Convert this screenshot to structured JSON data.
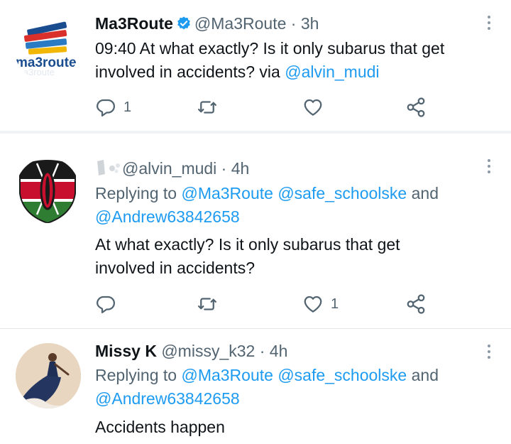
{
  "tweets": [
    {
      "name": "Ma3Route",
      "handle": "@Ma3Route",
      "time": "3h",
      "verified": true,
      "text": "09:40 At what exactly? Is it only subarus that get involved in accidents? via ",
      "via_link": "@alvin_mudi",
      "actions": {
        "reply_count": "1",
        "retweet_count": "",
        "like_count": ""
      },
      "avatar": {
        "logo_text": "ma3route"
      }
    },
    {
      "name": "",
      "handle": "@alvin_mudi",
      "time": "4h",
      "replying_prefix": "Replying to ",
      "replying_mentions": "@Ma3Route @safe_schoolske",
      "replying_and": " and",
      "replying_mention2": "@Andrew63842658",
      "text": "At what exactly? Is it only subarus that get involved in accidents?",
      "actions": {
        "reply_count": "",
        "retweet_count": "",
        "like_count": "1"
      }
    },
    {
      "name": "Missy K",
      "handle": "@missy_k32",
      "time": "4h",
      "replying_prefix": "Replying to ",
      "replying_mentions": "@Ma3Route @safe_schoolske",
      "replying_and": " and",
      "replying_mention2": "@Andrew63842658",
      "text": "Accidents happen"
    }
  ],
  "separator": " · ",
  "colors": {
    "link": "#1d9bf0",
    "secondary": "#536471",
    "verified": "#1d9bf0"
  },
  "icons": [
    "reply-icon",
    "retweet-icon",
    "like-icon",
    "share-icon",
    "more-icon",
    "verified-icon"
  ]
}
